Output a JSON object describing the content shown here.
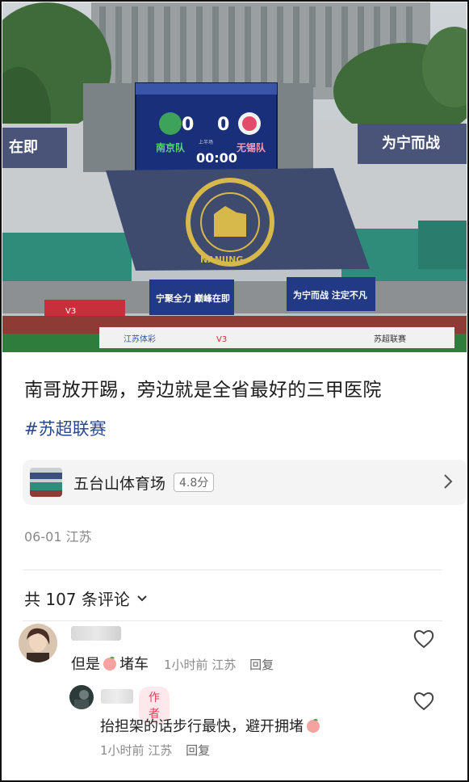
{
  "photo": {
    "scoreboard": {
      "home_team": "南京队",
      "away_team": "无锡队",
      "home_score": "0",
      "away_score": "0",
      "clock": "00:00",
      "half": "上半场"
    },
    "banner_left": "宁聚全力 巅峰在即",
    "banner_right": "为宁而战 注定不凡",
    "stand_sign_left": "在即",
    "stand_sign_right": "为宁而战",
    "flag_text": "NANJING",
    "ad_boards": [
      "江苏体彩",
      "V3",
      "苏超联赛"
    ]
  },
  "post": {
    "text": "南哥放开踢，旁边就是全省最好的三甲医院",
    "hashtag": "#苏超联赛",
    "location": {
      "name": "五台山体育场",
      "rating": "4.8分"
    },
    "date": "06-01",
    "region": "江苏"
  },
  "comments_header": {
    "label": "共 107 条评论"
  },
  "comments": [
    {
      "text_before": "但是",
      "emoji": "peach-emoji",
      "text_after": "堵车",
      "time": "1小时前",
      "region": "江苏",
      "reply_label": "回复"
    },
    {
      "author_tag": "作者",
      "text_before": "抬担架的话步行最快，避开拥堵",
      "emoji": "peach-emoji",
      "time": "1小时前",
      "region": "江苏",
      "reply_label": "回复"
    }
  ],
  "icons": {
    "chevron": "chevron-right-icon",
    "expand": "chevron-down-icon",
    "like": "heart-outline-icon"
  },
  "colors": {
    "hashtag": "#2a4a8a",
    "author_tag": "#e0405a",
    "scoreboard": "#1a2f7a",
    "pitch": "#2e7d3c",
    "flag": "#3e4a6e"
  }
}
